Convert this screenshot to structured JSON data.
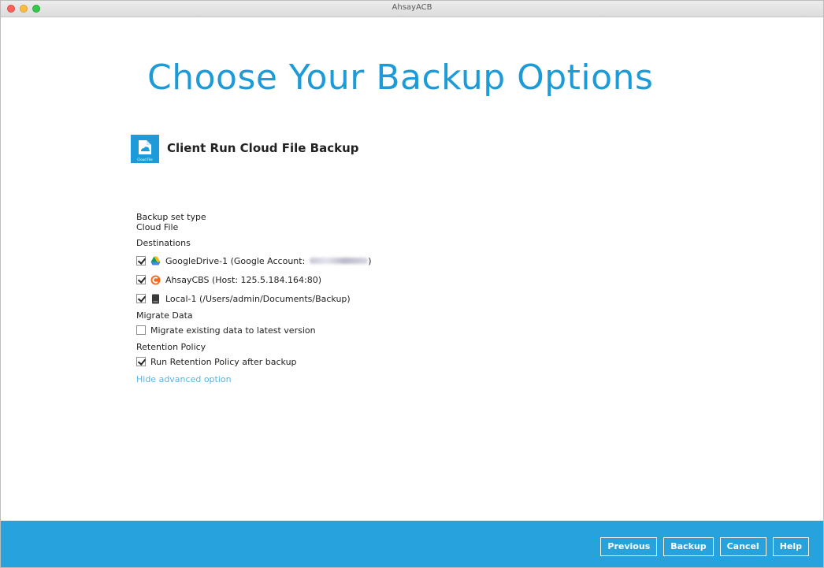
{
  "window": {
    "title": "AhsayACB"
  },
  "page": {
    "title": "Choose Your Backup Options"
  },
  "module": {
    "title": "Client Run Cloud File Backup",
    "icon_caption": "Cloud File",
    "icon": "cloud-file-icon"
  },
  "backup_set": {
    "type_label": "Backup set type",
    "type_value": "Cloud File"
  },
  "destinations": {
    "heading": "Destinations",
    "items": [
      {
        "label": "GoogleDrive-1 (Google Account:",
        "suffix": ")",
        "checked": true,
        "icon": "google-drive-icon"
      },
      {
        "label": "AhsayCBS (Host: 125.5.184.164:80)",
        "checked": true,
        "icon": "ahsay-cbs-icon"
      },
      {
        "label": "Local-1 (/Users/admin/Documents/Backup)",
        "checked": true,
        "icon": "local-drive-icon"
      }
    ]
  },
  "migrate": {
    "heading": "Migrate Data",
    "option": "Migrate existing data to latest version",
    "checked": false
  },
  "retention": {
    "heading": "Retention Policy",
    "option": "Run Retention Policy after backup",
    "checked": true
  },
  "advanced_link": "Hide advanced option",
  "buttons": {
    "previous": "Previous",
    "backup": "Backup",
    "cancel": "Cancel",
    "help": "Help"
  },
  "colors": {
    "accent": "#1d9bd8",
    "footer": "#27a2dd",
    "link": "#56b5e6"
  }
}
